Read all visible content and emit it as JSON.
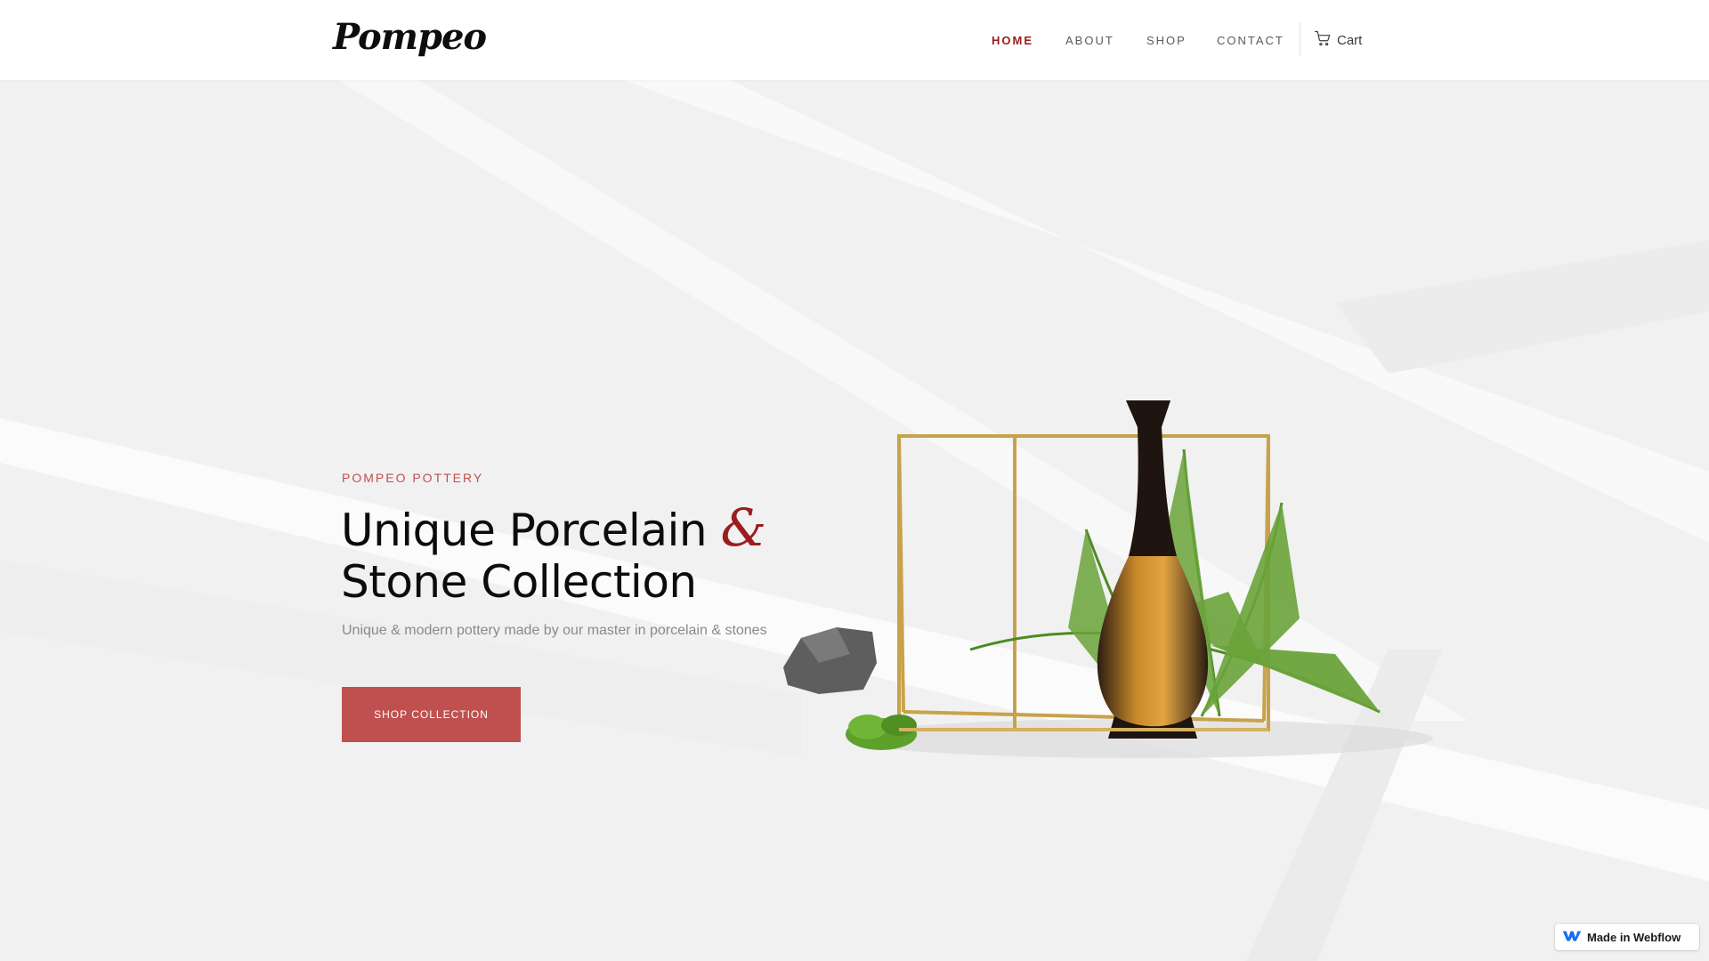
{
  "header": {
    "logo": "Pompeo",
    "nav": [
      {
        "label": "HOME",
        "active": true
      },
      {
        "label": "ABOUT",
        "active": false
      },
      {
        "label": "SHOP",
        "active": false
      },
      {
        "label": "CONTACT",
        "active": false
      }
    ],
    "cart_label": "Cart"
  },
  "hero": {
    "eyebrow": "POMPEO POTTERY",
    "title_line1": "Unique Porcelain",
    "title_amp": "&",
    "title_line2": "Stone Collection",
    "subtitle": "Unique & modern pottery made by our master in porcelain & stones",
    "cta_label": "SHOP COLLECTION"
  },
  "badge": {
    "label": "Made in Webflow"
  },
  "colors": {
    "accent": "#c0504f",
    "nav_active": "#9b1d1d",
    "background": "#f3f3f3"
  },
  "icons": [
    "cart-icon",
    "webflow-logo-icon"
  ]
}
